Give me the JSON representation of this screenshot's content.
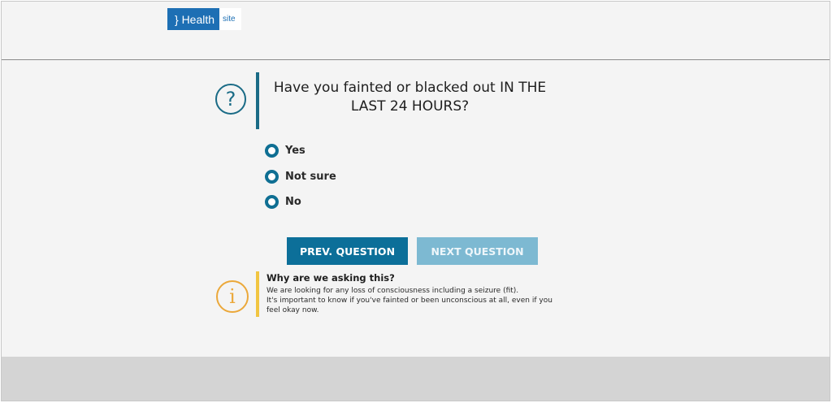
{
  "header": {
    "logo_main": "} Health",
    "logo_sub": "site"
  },
  "question": {
    "icon": "question-icon",
    "text": "Have you fainted or blacked out IN THE LAST 24 HOURS?"
  },
  "options": [
    {
      "label": "Yes"
    },
    {
      "label": "Not sure"
    },
    {
      "label": "No"
    }
  ],
  "buttons": {
    "prev_label": "PREV. QUESTION",
    "next_label": "NEXT QUESTION"
  },
  "info": {
    "icon": "info-icon",
    "title": "Why are we asking this?",
    "line1": "We are looking for any loss of consciousness including a seizure (fit).",
    "line2": "It's important to know if you've fainted or been unconscious at all, even if you feel okay now."
  },
  "colors": {
    "primary": "#0c6f99",
    "primary_disabled": "#7db9d2",
    "info_accent": "#f1c541",
    "logo_blue": "#1d6fb4"
  }
}
